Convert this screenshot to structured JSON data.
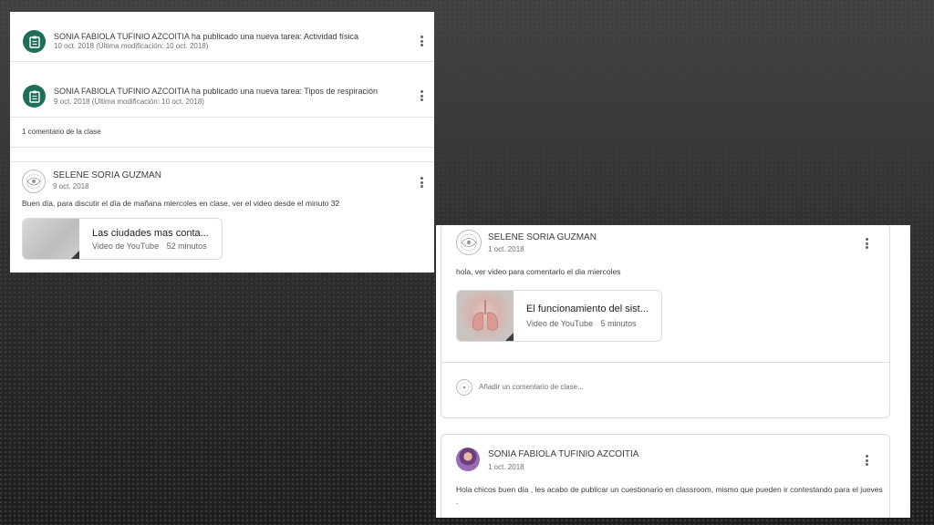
{
  "left_panel": {
    "assignments": [
      {
        "text": "SONIA FABIOLA TUFINIO AZCOITIA ha publicado una nueva tarea: Actividad física",
        "date": "10 oct. 2018 (Última modificación: 10 oct. 2018)"
      },
      {
        "text": "SONIA FABIOLA TUFINIO AZCOITIA ha publicado una nueva tarea: Tipos de respiración",
        "date": "9 oct. 2018 (Última modificación: 10 oct. 2018)"
      }
    ],
    "comment_count": "1 comentario de la clase",
    "post": {
      "author": "SELENE SORIA GUZMAN",
      "date": "9 oct. 2018",
      "body": "Buen día, para discutir el día de mañana miercoles en clase, ver el video desde el minuto 32",
      "video": {
        "title": "Las ciudades mas conta...",
        "source": "Video de YouTube",
        "duration": "52 minutos"
      }
    }
  },
  "right_panel": {
    "post": {
      "author": "SELENE SORIA GUZMAN",
      "date": "1 oct. 2018",
      "body": "hola, ver video para comentarlo el dia miercoles",
      "video": {
        "title": "El funcionamiento del sist...",
        "source": "Video de YouTube",
        "duration": "5 minutos"
      }
    },
    "comment_placeholder": "Añadir un comentario de clase...",
    "post2": {
      "author": "SONIA FABIOLA TUFINIO AZCOITIA",
      "date": "1 oct. 2018",
      "body": "Hola chicos buen día , les acabo de publicar un cuestionario en classroom, mismo que pueden ir contestando para el jueves",
      "body_tail": "."
    }
  },
  "colors": {
    "assignment_icon": "#1e6e5a",
    "background": "#2e2e2e"
  }
}
